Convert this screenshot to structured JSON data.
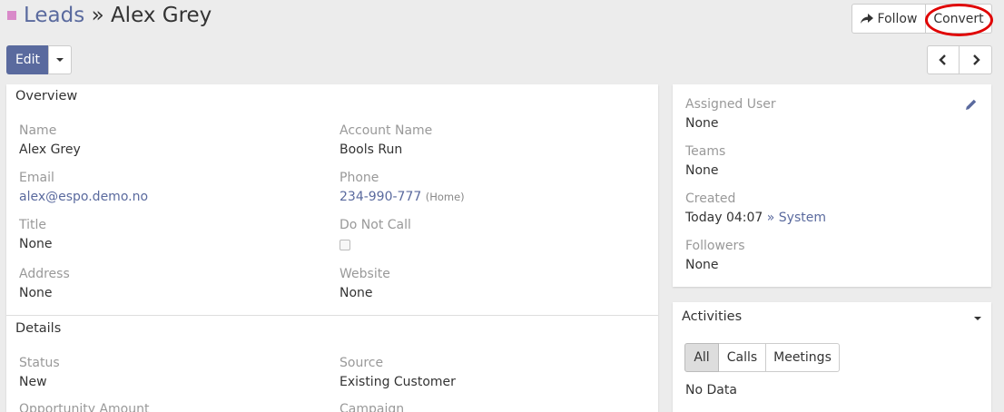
{
  "header": {
    "breadcrumb": "Leads",
    "separator": "»",
    "record_name": "Alex Grey",
    "follow_label": "Follow",
    "convert_label": "Convert"
  },
  "toolbar": {
    "edit_label": "Edit"
  },
  "overview": {
    "title": "Overview",
    "fields": {
      "name": {
        "label": "Name",
        "value": "Alex Grey"
      },
      "account_name": {
        "label": "Account Name",
        "value": "Bools Run"
      },
      "email": {
        "label": "Email",
        "value": "alex@espo.demo.no"
      },
      "phone": {
        "label": "Phone",
        "value": "234-990-777",
        "type": "(Home)"
      },
      "title": {
        "label": "Title",
        "value": "None"
      },
      "do_not_call": {
        "label": "Do Not Call",
        "checked": false
      },
      "address": {
        "label": "Address",
        "value": "None"
      },
      "website": {
        "label": "Website",
        "value": "None"
      }
    }
  },
  "details": {
    "title": "Details",
    "fields": {
      "status": {
        "label": "Status",
        "value": "New"
      },
      "source": {
        "label": "Source",
        "value": "Existing Customer"
      },
      "opportunity_amount": {
        "label": "Opportunity Amount"
      },
      "campaign": {
        "label": "Campaign"
      }
    }
  },
  "side": {
    "assigned_user": {
      "label": "Assigned User",
      "value": "None"
    },
    "teams": {
      "label": "Teams",
      "value": "None"
    },
    "created": {
      "label": "Created",
      "value": "Today 04:07",
      "separator": "»",
      "by": "System"
    },
    "followers": {
      "label": "Followers",
      "value": "None"
    }
  },
  "activities": {
    "title": "Activities",
    "tabs": [
      "All",
      "Calls",
      "Meetings"
    ],
    "active_tab": "All",
    "empty_text": "No Data"
  },
  "colors": {
    "accent": "#5a6a9e",
    "scope": "#d98ac9",
    "highlight_circle": "#e00000"
  }
}
